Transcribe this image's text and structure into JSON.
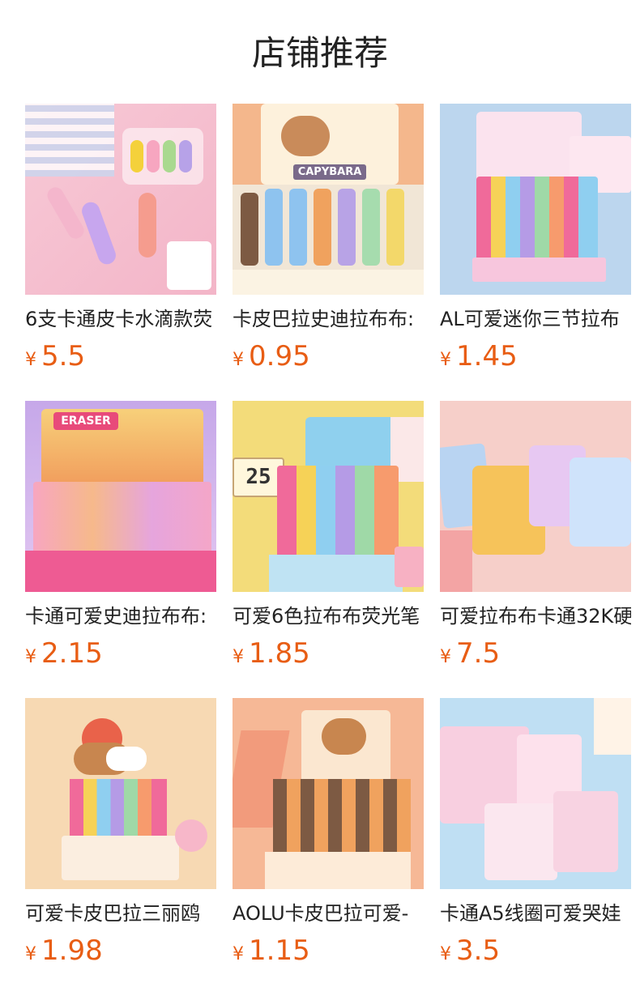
{
  "page_title": "店铺推荐",
  "currency_symbol": "¥",
  "colors": {
    "price": "#e85d14",
    "title": "#222222"
  },
  "products": [
    {
      "name": "6支卡通皮卡水滴款荧",
      "price": "5.5",
      "image": "pikachu-pens-pouch"
    },
    {
      "name": "卡皮巴拉史迪拉布布:",
      "price": "0.95",
      "image": "capybara-display-box"
    },
    {
      "name": "AL可爱迷你三节拉布",
      "price": "1.45",
      "image": "labubu-fluorescent-pen-box"
    },
    {
      "name": "卡通可爱史迪拉布布:",
      "price": "2.15",
      "image": "eraser-display-box"
    },
    {
      "name": "可爱6色拉布布荧光笔",
      "price": "1.85",
      "image": "labubu-highlighter-box"
    },
    {
      "name": "可爱拉布布卡通32K硬",
      "price": "7.5",
      "image": "labubu-notebooks"
    },
    {
      "name": "可爱卡皮巴拉三丽鸥",
      "price": "1.98",
      "image": "capybara-2in1-pen-box"
    },
    {
      "name": "AOLU卡皮巴拉可爱-",
      "price": "1.15",
      "image": "aolu-capybara-pen-box"
    },
    {
      "name": "卡通A5线圈可爱哭娃",
      "price": "3.5",
      "image": "spiral-notebooks"
    }
  ],
  "image_text": {
    "capybara_box": "CAPYBARA",
    "eraser_box": "ERASER",
    "calendar_day": "25"
  }
}
